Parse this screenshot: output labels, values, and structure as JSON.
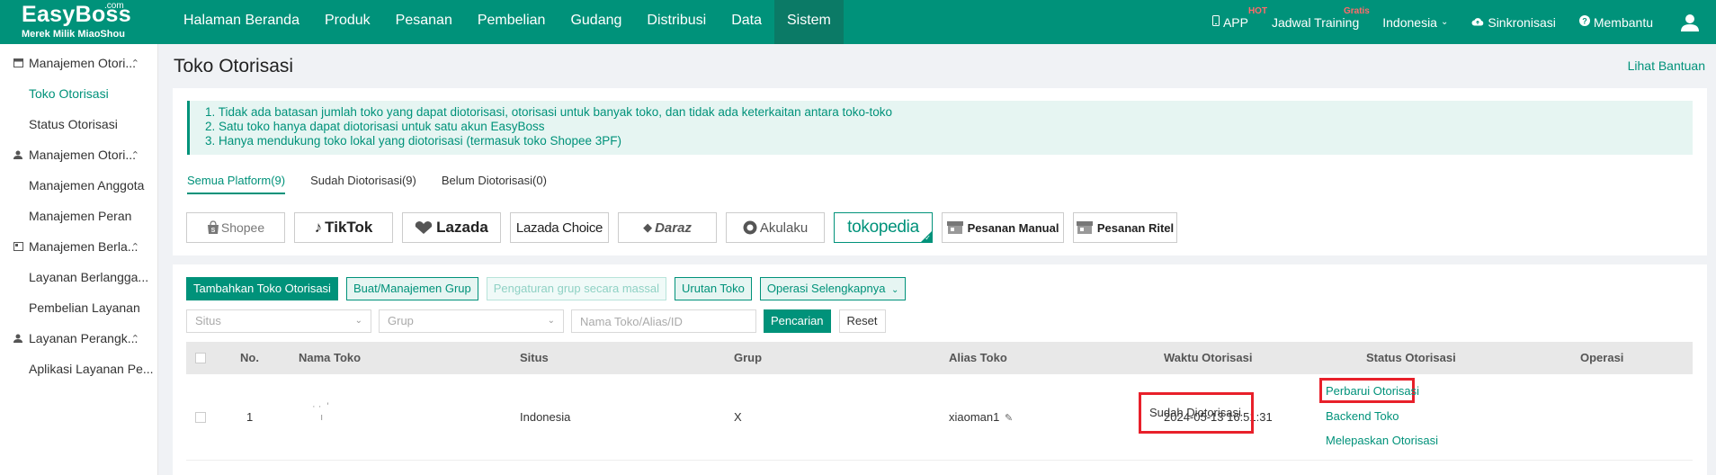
{
  "brand": {
    "name": "EasyBoss",
    "com": ".com",
    "subtitle": "Merek Milik MiaoShou"
  },
  "nav": [
    "Halaman Beranda",
    "Produk",
    "Pesanan",
    "Pembelian",
    "Gudang",
    "Distribusi",
    "Data",
    "Sistem"
  ],
  "nav_right": {
    "app": "APP",
    "app_badge": "HOT",
    "training": "Jadwal Training",
    "training_badge": "Gratis",
    "language": "Indonesia",
    "sync": "Sinkronisasi",
    "help": "Membantu"
  },
  "sidebar": [
    {
      "group": "Manajemen Otori...",
      "items": [
        "Toko Otorisasi",
        "Status Otorisasi"
      ]
    },
    {
      "group": "Manajemen Otori...",
      "items": [
        "Manajemen Anggota",
        "Manajemen Peran"
      ]
    },
    {
      "group": "Manajemen Berla...",
      "items": [
        "Layanan Berlangga...",
        "Pembelian Layanan"
      ]
    },
    {
      "group": "Layanan Perangk...",
      "items": [
        "Aplikasi Layanan Pe..."
      ]
    }
  ],
  "page": {
    "title": "Toko Otorisasi",
    "help_link": "Lihat Bantuan"
  },
  "notice": [
    "1. Tidak ada batasan jumlah toko yang dapat diotorisasi, otorisasi untuk banyak toko, dan tidak ada keterkaitan antara toko-toko",
    "2. Satu toko hanya dapat diotorisasi untuk satu akun EasyBoss",
    "3. Hanya mendukung toko lokal yang diotorisasi (termasuk toko Shopee 3PF)"
  ],
  "tabs": [
    "Semua Platform(9)",
    "Sudah Diotorisasi(9)",
    "Belum Diotorisasi(0)"
  ],
  "platforms": [
    "Shopee",
    "TikTok",
    "Lazada",
    "Lazada Choice",
    "Daraz",
    "Akulaku",
    "tokopedia",
    "Pesanan Manual",
    "Pesanan Ritel"
  ],
  "actions": {
    "add": "Tambahkan Toko Otorisasi",
    "group": "Buat/Manajemen Grup",
    "mass_group": "Pengaturan grup secara massal",
    "sort": "Urutan Toko",
    "more": "Operasi Selengkapnya"
  },
  "filters": {
    "site_placeholder": "Situs",
    "group_placeholder": "Grup",
    "search_placeholder": "Nama Toko/Alias/ID",
    "search_btn": "Pencarian",
    "reset_btn": "Reset"
  },
  "table": {
    "headers": [
      "No.",
      "Nama Toko",
      "Situs",
      "Grup",
      "Alias Toko",
      "Waktu Otorisasi",
      "Status Otorisasi",
      "Operasi"
    ],
    "rows": [
      {
        "no": "1",
        "site": "Indonesia",
        "group": "X",
        "alias": "xiaoman1",
        "time": "2024-05-13 16:51:31",
        "status": "Sudah Diotorisasi",
        "ops": [
          "Perbarui Otorisasi",
          "Backend Toko",
          "Melepaskan Otorisasi"
        ]
      }
    ]
  },
  "colors": {
    "primary": "#00927a",
    "highlight": "#e8202a"
  }
}
